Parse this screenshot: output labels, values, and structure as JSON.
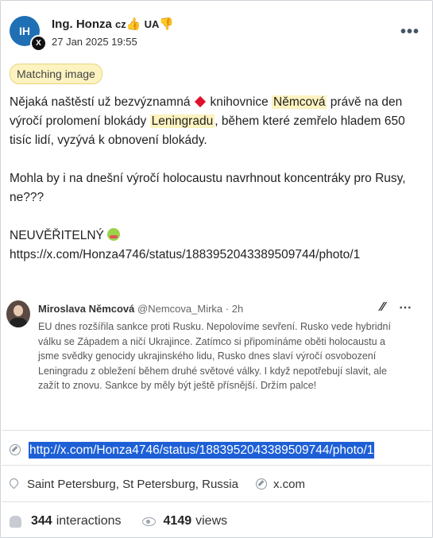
{
  "post": {
    "avatar_initials": "IH",
    "platform_badge": "X",
    "author_name": "Ing. Honza",
    "author_country": "cz",
    "author_tag": "UA",
    "timestamp": "27 Jan 2025 19:55",
    "badge": "Matching image",
    "text_p1_a": "Nějaká naštěstí už bezvýznamná",
    "text_p1_b": "knihovnice",
    "text_p1_hl1": "Němcová",
    "text_p1_c": "právě na den výročí prolomení blokády",
    "text_p1_hl2": "Leningradu",
    "text_p1_d": ", během které zemřelo hladem 650 tisíc lidí, vyzývá k obnovení blokády.",
    "text_p2": "Mohla by i na dnešní výročí holocaustu navrhnout koncentráky pro Rusy, ne???",
    "text_p3": "NEUVĚŘITELNÝ",
    "text_url": "https://x.com/Honza4746/status/1883952043389509744/photo/1"
  },
  "quoted": {
    "name": "Miroslava Němcová",
    "handle": "@Nemcova_Mirka",
    "age": "· 2h",
    "text": "EU dnes rozšířila sankce proti Rusku. Nepolovíme sevření. Rusko vede hybridní válku se Západem a ničí Ukrajince. Zatímco si připomínáme oběti holocaustu a jsme svědky genocidy ukrajinského lidu, Rusko dnes slaví výročí osvobození Leningradu z obležení během druhé světové války. I když nepotřebují slavit, ale zažít to znovu. Sankce by měly být ještě přísnější. Držím palce!"
  },
  "link": {
    "url": "http://x.com/Honza4746/status/1883952043389509744/photo/1"
  },
  "meta": {
    "location": "Saint Petersburg, St Petersburg, Russia",
    "source": "x.com"
  },
  "stats": {
    "interactions_count": "344",
    "interactions_label": "interactions",
    "views_count": "4149",
    "views_label": "views"
  }
}
